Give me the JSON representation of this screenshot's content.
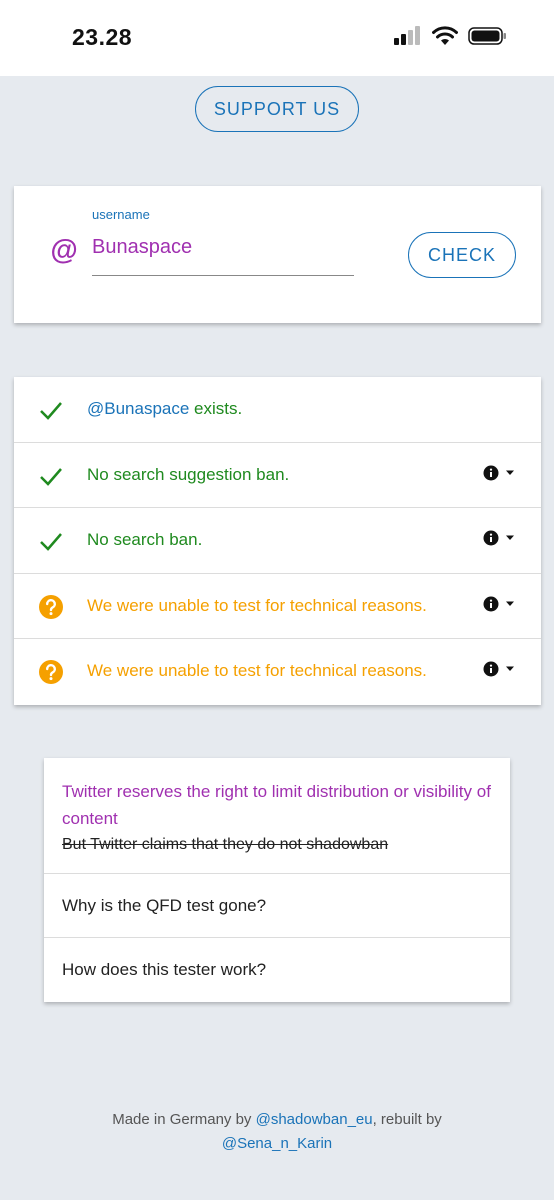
{
  "status_bar": {
    "time": "23.28"
  },
  "support_button": "SUPPORT US",
  "search": {
    "at_symbol": "@",
    "label": "username",
    "value": "Bunaspace",
    "check_label": "CHECK"
  },
  "results": [
    {
      "status": "ok",
      "handle": "@Bunaspace",
      "text": " exists.",
      "has_info": false
    },
    {
      "status": "ok",
      "text": "No search suggestion ban.",
      "has_info": true
    },
    {
      "status": "ok",
      "text": "No search ban.",
      "has_info": true
    },
    {
      "status": "unknown",
      "text": "We were unable to test for technical reasons.",
      "has_info": true
    },
    {
      "status": "unknown",
      "text": "We were unable to test for technical reasons.",
      "has_info": true
    }
  ],
  "faq": {
    "item1_title": "Twitter reserves the right to limit distribution or visibility of content",
    "item1_strike": "But Twitter claims that they do not shadowban",
    "item2": "Why is the QFD test gone?",
    "item3": "How does this tester work?"
  },
  "footer": {
    "prefix": "Made in Germany by ",
    "link1": "@shadowban_eu",
    "middle": ", rebuilt by",
    "link2": "@Sena_n_Karin"
  },
  "colors": {
    "accent_blue": "#1a73b8",
    "purple": "#a030b0",
    "success_green": "#1f8a1f",
    "warning_orange": "#f5a000",
    "background": "#e6eaef"
  }
}
